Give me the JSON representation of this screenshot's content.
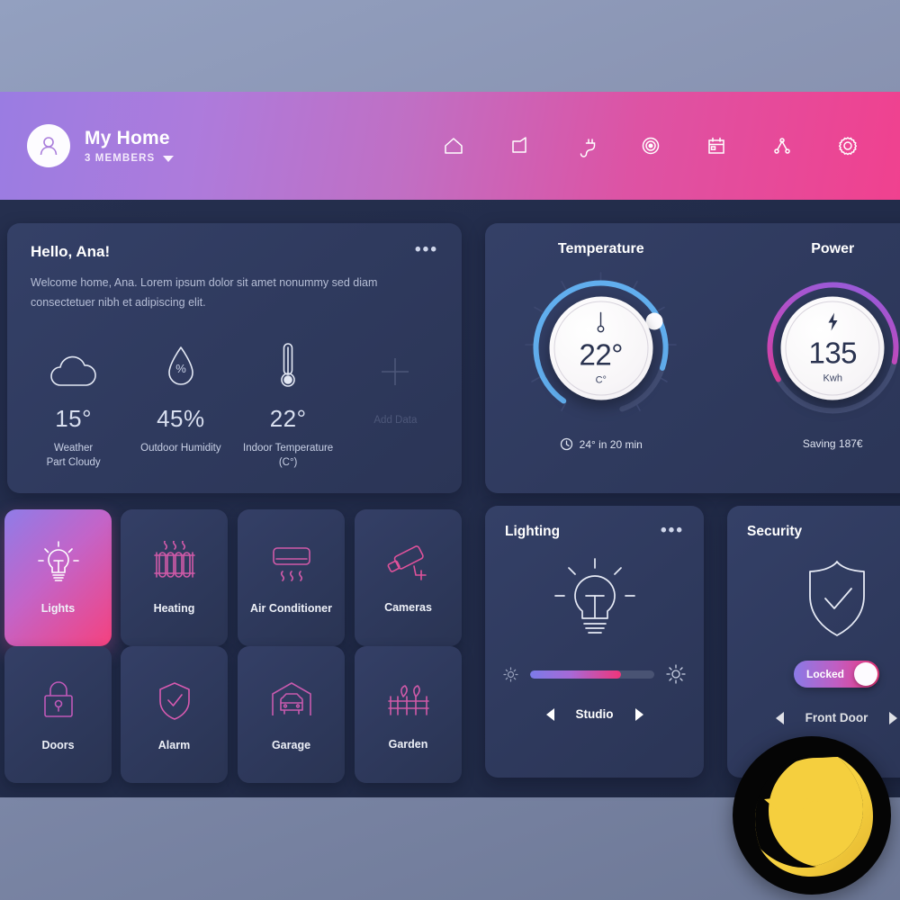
{
  "header": {
    "title": "My Home",
    "members": "3 MEMBERS",
    "avatar_icon": "user-avatar-icon",
    "caret_icon": "chevron-down-icon",
    "nav": [
      {
        "name": "home-icon",
        "label": "Home"
      },
      {
        "name": "rooms-icon",
        "label": "Rooms"
      },
      {
        "name": "plug-icon",
        "label": "Devices"
      },
      {
        "name": "target-icon",
        "label": "Automation"
      },
      {
        "name": "calendar-icon",
        "label": "Schedule"
      },
      {
        "name": "network-icon",
        "label": "Network"
      },
      {
        "name": "gear-icon",
        "label": "Settings"
      }
    ],
    "gradient_from": "#9a7ce2",
    "gradient_to": "#f0418f"
  },
  "welcome": {
    "greeting": "Hello, Ana!",
    "message": "Welcome home, Ana. Lorem ipsum dolor sit amet nonummy sed diam consectetuer nibh et adipiscing elit.",
    "menu_icon": "more-options-icon",
    "stats": [
      {
        "icon": "cloud-icon",
        "value": "15°",
        "label": "Weather",
        "sublabel": "Part Cloudy",
        "muted": false
      },
      {
        "icon": "humidity-drop-icon",
        "value": "45%",
        "label": "Outdoor Humidity",
        "sublabel": "",
        "muted": false
      },
      {
        "icon": "thermometer-icon",
        "value": "22°",
        "label": "Indoor Temperature",
        "sublabel": "(C°)",
        "muted": false
      },
      {
        "icon": "plus-icon",
        "value": "",
        "label": "Add Data",
        "sublabel": "",
        "muted": true
      }
    ]
  },
  "gauges": [
    {
      "title": "Temperature",
      "value": "22°",
      "unit": "C°",
      "icon": "thermometer-icon",
      "footer": "24° in 20 min",
      "footer_icon": "clock-icon",
      "arc_color": "#61aeee",
      "arc_percent": 72
    },
    {
      "title": "Power",
      "value": "135",
      "unit": "Kwh",
      "icon": "lightning-bolt-icon",
      "footer": "Saving 187€",
      "footer_icon": "",
      "arc_color": "#e8389a",
      "arc_percent": 62
    }
  ],
  "tiles": [
    {
      "label": "Lights",
      "icon": "lightbulb-icon",
      "active": true
    },
    {
      "label": "Heating",
      "icon": "radiator-icon",
      "active": false
    },
    {
      "label": "Air Conditioner",
      "icon": "air-conditioner-icon",
      "active": false
    },
    {
      "label": "Cameras",
      "icon": "security-camera-icon",
      "active": false
    },
    {
      "label": "Doors",
      "icon": "padlock-icon",
      "active": false
    },
    {
      "label": "Alarm",
      "icon": "shield-check-icon",
      "active": false
    },
    {
      "label": "Garage",
      "icon": "garage-car-icon",
      "active": false
    },
    {
      "label": "Garden",
      "icon": "garden-fence-icon",
      "active": false
    }
  ],
  "lighting": {
    "title": "Lighting",
    "menu_icon": "more-options-icon",
    "bulb_icon": "lightbulb-glow-icon",
    "brightness_percent": 73,
    "low_icon": "brightness-low-icon",
    "high_icon": "brightness-high-icon",
    "room": "Studio",
    "prev_icon": "arrow-left-icon",
    "next_icon": "arrow-right-icon"
  },
  "security": {
    "title": "Security",
    "shield_icon": "shield-check-icon",
    "toggle_label": "Locked",
    "toggle_on": true,
    "device": "Front Door",
    "prev_icon": "arrow-left-icon",
    "next_icon": "arrow-right-icon"
  },
  "night_badge": {
    "icon": "crescent-moon-stars-icon",
    "label": "Night Mode",
    "moon_color": "#f5cf3e",
    "bg_color": "#050505"
  }
}
